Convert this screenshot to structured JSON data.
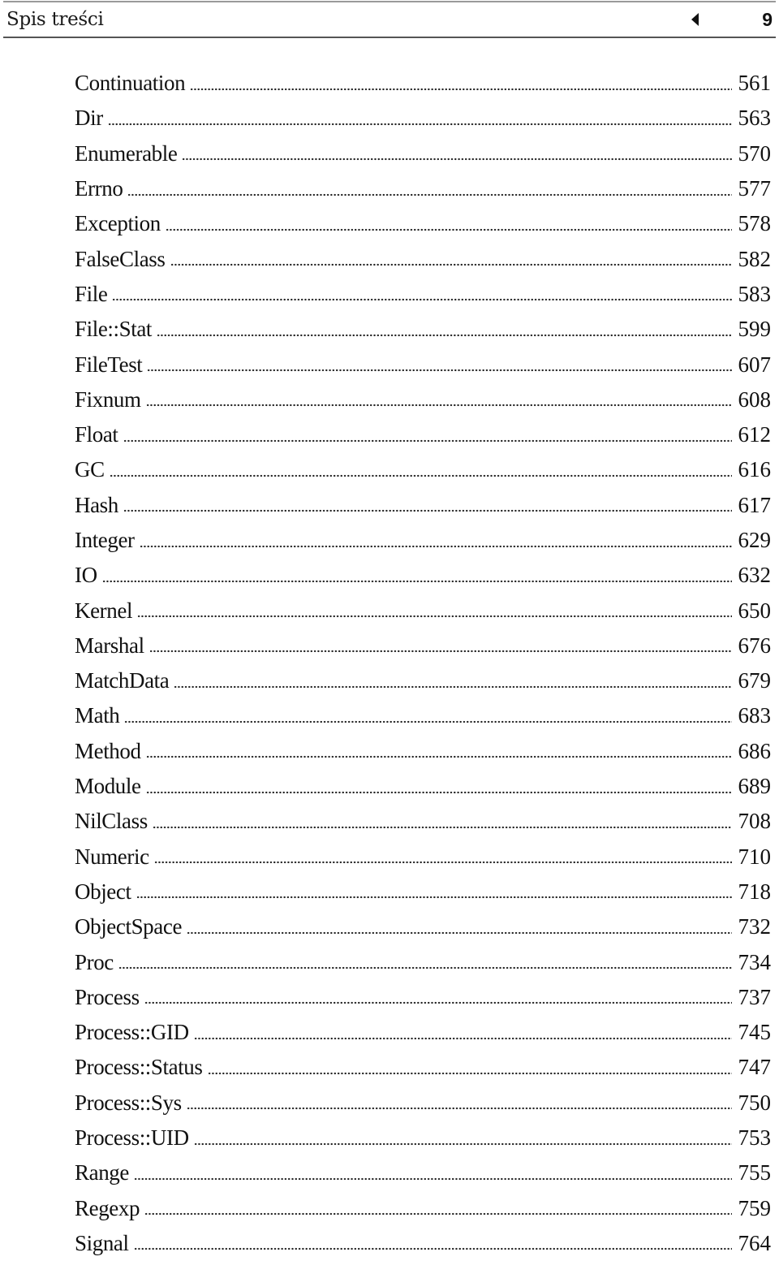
{
  "header": {
    "title": "Spis treści",
    "page_number": "9",
    "nav_icon": "triangle-left-icon"
  },
  "toc": [
    {
      "name": "Continuation",
      "page": "561"
    },
    {
      "name": "Dir",
      "page": "563"
    },
    {
      "name": "Enumerable",
      "page": "570"
    },
    {
      "name": "Errno",
      "page": "577"
    },
    {
      "name": "Exception",
      "page": "578"
    },
    {
      "name": "FalseClass",
      "page": "582"
    },
    {
      "name": "File",
      "page": "583"
    },
    {
      "name": "File::Stat",
      "page": "599"
    },
    {
      "name": "FileTest",
      "page": "607"
    },
    {
      "name": "Fixnum",
      "page": "608"
    },
    {
      "name": "Float",
      "page": "612"
    },
    {
      "name": "GC",
      "page": "616"
    },
    {
      "name": "Hash",
      "page": "617"
    },
    {
      "name": "Integer",
      "page": "629"
    },
    {
      "name": "IO",
      "page": "632"
    },
    {
      "name": "Kernel",
      "page": "650"
    },
    {
      "name": "Marshal",
      "page": "676"
    },
    {
      "name": "MatchData",
      "page": "679"
    },
    {
      "name": "Math",
      "page": "683"
    },
    {
      "name": "Method",
      "page": "686"
    },
    {
      "name": "Module",
      "page": "689"
    },
    {
      "name": "NilClass",
      "page": "708"
    },
    {
      "name": "Numeric",
      "page": "710"
    },
    {
      "name": "Object",
      "page": "718"
    },
    {
      "name": "ObjectSpace",
      "page": "732"
    },
    {
      "name": "Proc",
      "page": "734"
    },
    {
      "name": "Process",
      "page": "737"
    },
    {
      "name": "Process::GID",
      "page": "745"
    },
    {
      "name": "Process::Status",
      "page": "747"
    },
    {
      "name": "Process::Sys",
      "page": "750"
    },
    {
      "name": "Process::UID",
      "page": "753"
    },
    {
      "name": "Range",
      "page": "755"
    },
    {
      "name": "Regexp",
      "page": "759"
    },
    {
      "name": "Signal",
      "page": "764"
    }
  ]
}
